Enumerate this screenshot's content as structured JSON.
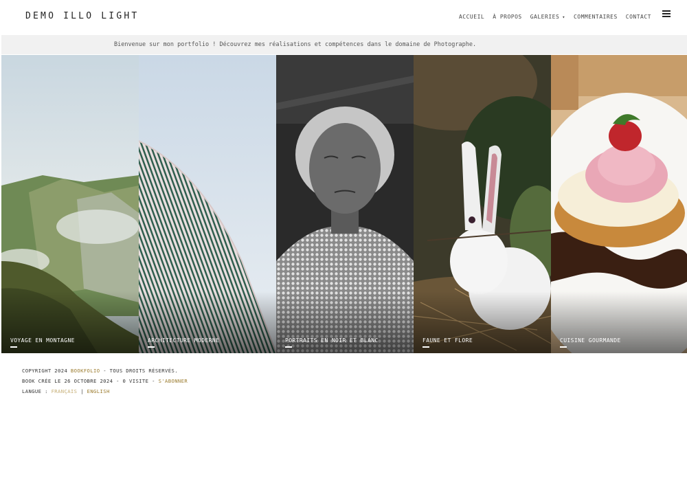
{
  "header": {
    "logo": "DEMO ILLO LIGHT",
    "nav": {
      "home": "ACCUEIL",
      "about": "À PROPOS",
      "galleries": "GALERIES",
      "comments": "COMMENTAIRES",
      "contact": "CONTACT"
    },
    "menu_icon": "hamburger-menu-icon"
  },
  "banner": {
    "text": "Bienvenue sur mon portfolio ! Découvrez mes réalisations et compétences dans le domaine de Photographe."
  },
  "gallery": {
    "items": [
      {
        "title": "VOYAGE EN MONTAGNE"
      },
      {
        "title": "ARCHITECTURE MODERNE"
      },
      {
        "title": "PORTRAITS EN NOIR ET BLANC"
      },
      {
        "title": "FAUNE ET FLORE"
      },
      {
        "title": "CUISINE GOURMANDE"
      }
    ]
  },
  "footer": {
    "copyright_prefix": "COPYRIGHT 2024",
    "brand_link": "BOOKFOLIO",
    "copyright_suffix": "- TOUS DROITS RÉSERVÉS.",
    "created": "BOOK CRÉE LE 26 OCTOBRE 2024 - 0 VISITE -",
    "subscribe": "S'ABONNER",
    "language_label": "LANGUE :",
    "lang_fr": "FRANÇAIS",
    "separator": "|",
    "lang_en": "ENGLISH"
  },
  "colors": {
    "accent_link": "#9a7a2c",
    "banner_bg": "#f1f1f1"
  }
}
